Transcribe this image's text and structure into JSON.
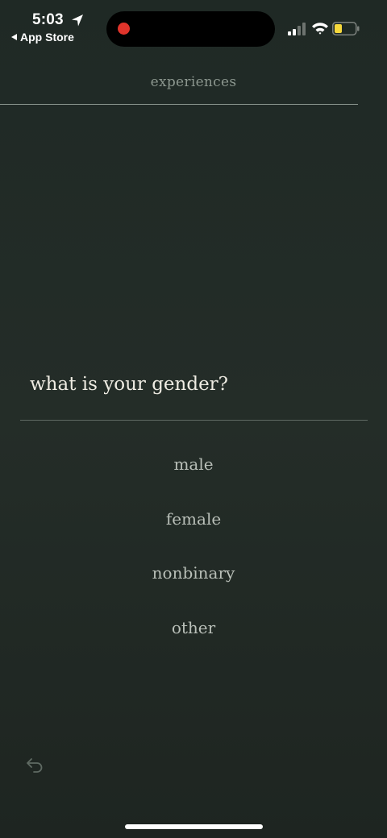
{
  "status_bar": {
    "time": "5:03",
    "back_app": "App Store",
    "icons": [
      "location-arrow-icon",
      "signal-icon",
      "wifi-icon",
      "battery-icon"
    ],
    "recording_color": "#e0342b",
    "battery_color": "#f5d83c"
  },
  "header": {
    "title": "experiences"
  },
  "question": {
    "text": "what is your gender?"
  },
  "options": [
    {
      "label": "male"
    },
    {
      "label": "female"
    },
    {
      "label": "nonbinary"
    },
    {
      "label": "other"
    }
  ],
  "navigation": {
    "back_icon": "undo-arrow-icon"
  },
  "colors": {
    "background": "#222b26",
    "text_primary": "#efece3",
    "text_secondary": "#b9bfb8",
    "text_muted": "#8c978f"
  }
}
